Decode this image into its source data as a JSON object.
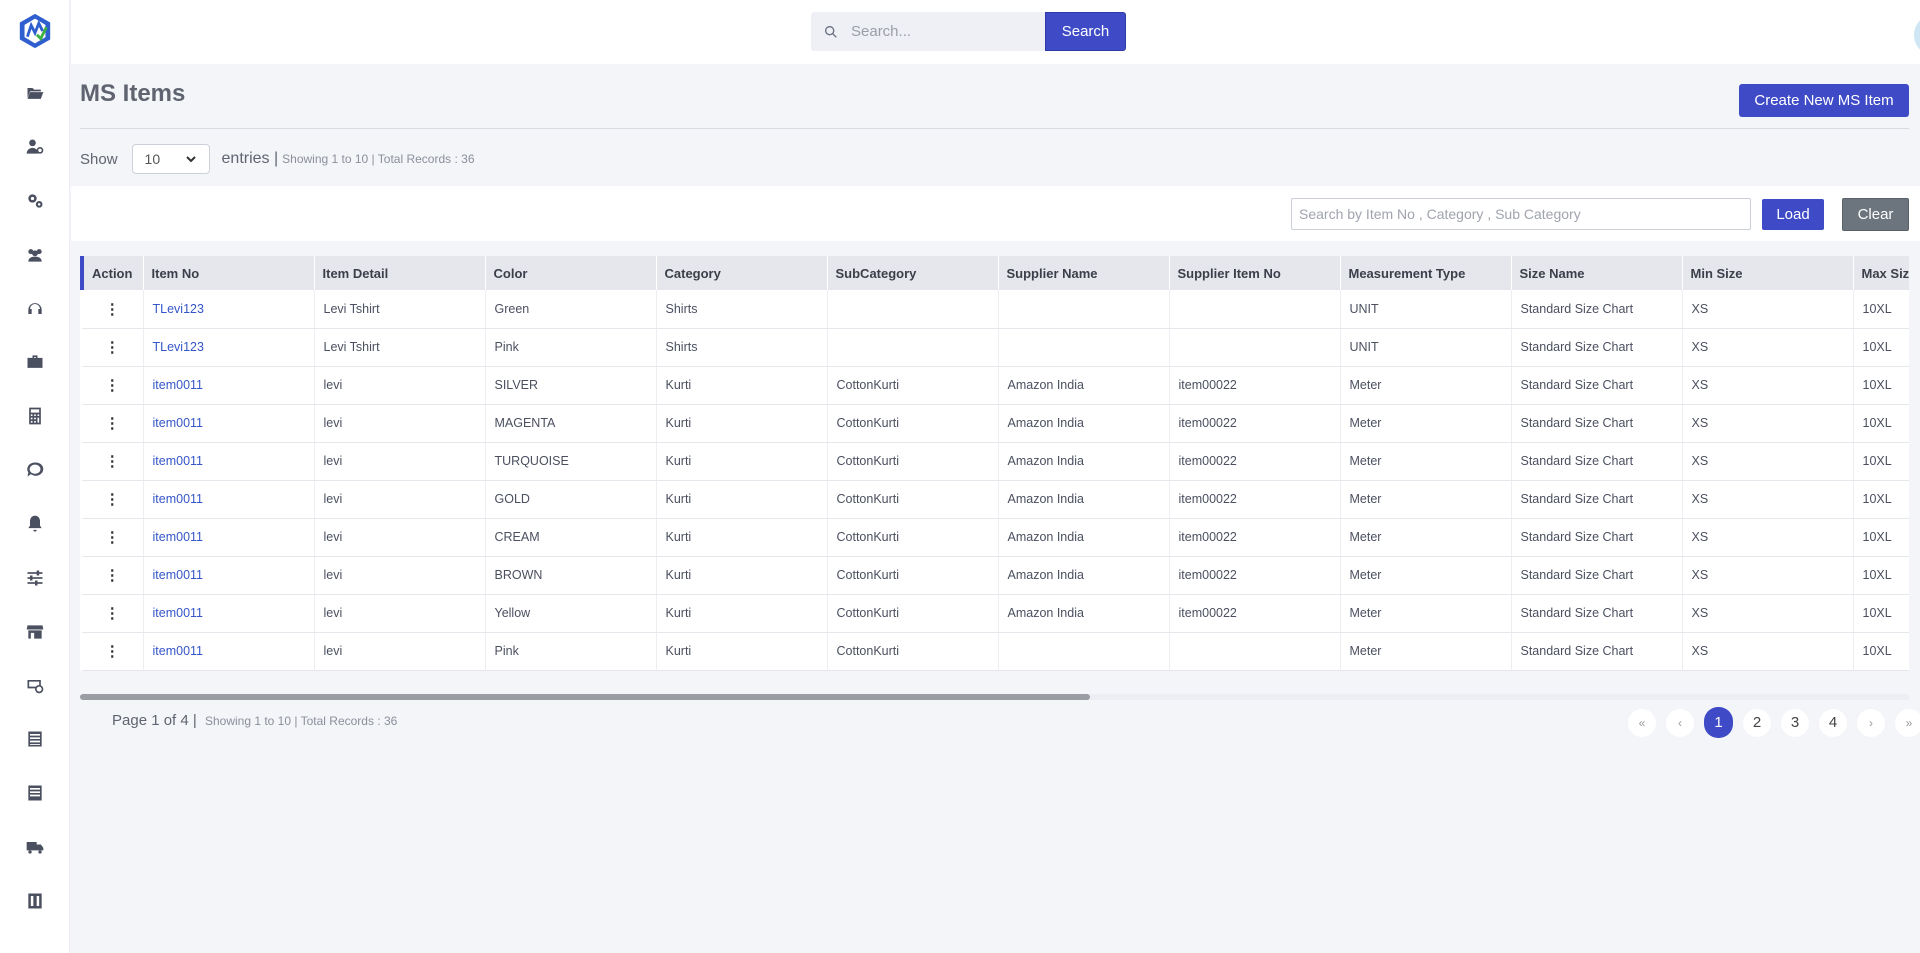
{
  "search": {
    "placeholder": "Search...",
    "button_label": "Search"
  },
  "page": {
    "title": "MS Items",
    "create_label": "Create New MS Item"
  },
  "entries": {
    "show_label": "Show",
    "page_size": "10",
    "entries_label": "entries |",
    "summary": "Showing 1 to 10 | Total Records : 36"
  },
  "filter": {
    "placeholder": "Search by Item No , Category , Sub Category",
    "load_label": "Load",
    "clear_label": "Clear"
  },
  "table": {
    "headers": [
      "Action",
      "Item No",
      "Item Detail",
      "Color",
      "Category",
      "SubCategory",
      "Supplier Name",
      "Supplier Item No",
      "Measurement Type",
      "Size Name",
      "Min Size",
      "Max Size"
    ],
    "rows": [
      {
        "action": "⋮",
        "item_no": "TLevi123",
        "item_detail": "Levi Tshirt",
        "color": "Green",
        "category": "Shirts",
        "subcategory": "",
        "supplier_name": "",
        "supplier_item_no": "",
        "measurement_type": "UNIT",
        "size_name": "Standard Size Chart",
        "min_size": "XS",
        "max_size": "10XL"
      },
      {
        "action": "⋮",
        "item_no": "TLevi123",
        "item_detail": "Levi Tshirt",
        "color": "Pink",
        "category": "Shirts",
        "subcategory": "",
        "supplier_name": "",
        "supplier_item_no": "",
        "measurement_type": "UNIT",
        "size_name": "Standard Size Chart",
        "min_size": "XS",
        "max_size": "10XL"
      },
      {
        "action": "⋮",
        "item_no": "item0011",
        "item_detail": "levi",
        "color": "SILVER",
        "category": "Kurti",
        "subcategory": "CottonKurti",
        "supplier_name": "Amazon India",
        "supplier_item_no": "item00022",
        "measurement_type": "Meter",
        "size_name": "Standard Size Chart",
        "min_size": "XS",
        "max_size": "10XL"
      },
      {
        "action": "⋮",
        "item_no": "item0011",
        "item_detail": "levi",
        "color": "MAGENTA",
        "category": "Kurti",
        "subcategory": "CottonKurti",
        "supplier_name": "Amazon India",
        "supplier_item_no": "item00022",
        "measurement_type": "Meter",
        "size_name": "Standard Size Chart",
        "min_size": "XS",
        "max_size": "10XL"
      },
      {
        "action": "⋮",
        "item_no": "item0011",
        "item_detail": "levi",
        "color": "TURQUOISE",
        "category": "Kurti",
        "subcategory": "CottonKurti",
        "supplier_name": "Amazon India",
        "supplier_item_no": "item00022",
        "measurement_type": "Meter",
        "size_name": "Standard Size Chart",
        "min_size": "XS",
        "max_size": "10XL"
      },
      {
        "action": "⋮",
        "item_no": "item0011",
        "item_detail": "levi",
        "color": "GOLD",
        "category": "Kurti",
        "subcategory": "CottonKurti",
        "supplier_name": "Amazon India",
        "supplier_item_no": "item00022",
        "measurement_type": "Meter",
        "size_name": "Standard Size Chart",
        "min_size": "XS",
        "max_size": "10XL"
      },
      {
        "action": "⋮",
        "item_no": "item0011",
        "item_detail": "levi",
        "color": "CREAM",
        "category": "Kurti",
        "subcategory": "CottonKurti",
        "supplier_name": "Amazon India",
        "supplier_item_no": "item00022",
        "measurement_type": "Meter",
        "size_name": "Standard Size Chart",
        "min_size": "XS",
        "max_size": "10XL"
      },
      {
        "action": "⋮",
        "item_no": "item0011",
        "item_detail": "levi",
        "color": "BROWN",
        "category": "Kurti",
        "subcategory": "CottonKurti",
        "supplier_name": "Amazon India",
        "supplier_item_no": "item00022",
        "measurement_type": "Meter",
        "size_name": "Standard Size Chart",
        "min_size": "XS",
        "max_size": "10XL"
      },
      {
        "action": "⋮",
        "item_no": "item0011",
        "item_detail": "levi",
        "color": "Yellow",
        "category": "Kurti",
        "subcategory": "CottonKurti",
        "supplier_name": "Amazon India",
        "supplier_item_no": "item00022",
        "measurement_type": "Meter",
        "size_name": "Standard Size Chart",
        "min_size": "XS",
        "max_size": "10XL"
      },
      {
        "action": "⋮",
        "item_no": "item0011",
        "item_detail": "levi",
        "color": "Pink",
        "category": "Kurti",
        "subcategory": "CottonKurti",
        "supplier_name": "",
        "supplier_item_no": "",
        "measurement_type": "Meter",
        "size_name": "Standard Size Chart",
        "min_size": "XS",
        "max_size": "10XL"
      }
    ]
  },
  "pagination": {
    "page_label": "Page 1 of 4 |",
    "summary": "Showing 1 to 10 | Total Records : 36",
    "first": "«",
    "prev": "‹",
    "next": "›",
    "last": "»",
    "pages": [
      "1",
      "2",
      "3",
      "4"
    ],
    "current": "1"
  },
  "sidebar": {
    "icons": [
      "folder-open-icon",
      "user-gear-icon",
      "cogs-icon",
      "users-icon",
      "headset-icon",
      "briefcase-icon",
      "calculator-icon",
      "chat-icon",
      "bell-icon",
      "sliders-icon",
      "store-icon",
      "money-icon",
      "receipt-icon",
      "list-icon",
      "truck-icon",
      "warehouse-icon"
    ]
  },
  "colors": {
    "accent": "#3f4bc6",
    "secondary": "#6c757d",
    "link": "#3556c8"
  }
}
